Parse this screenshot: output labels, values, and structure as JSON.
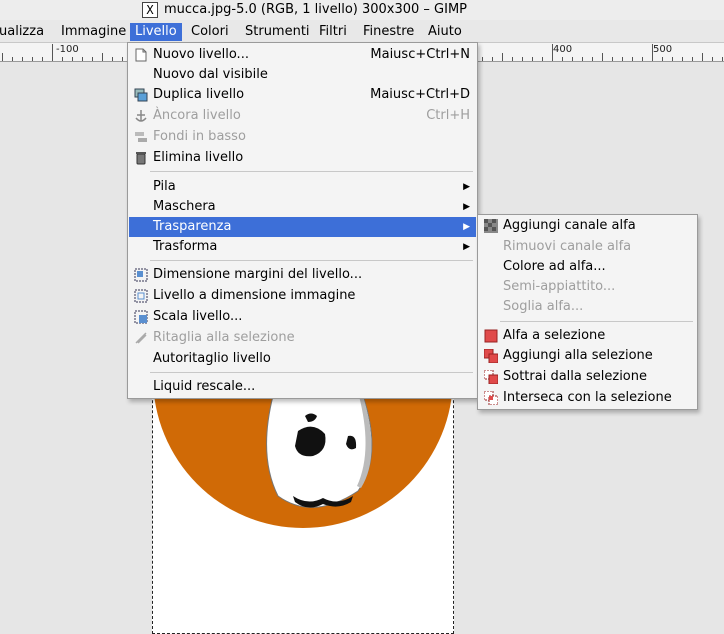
{
  "window": {
    "title": "mucca.jpg-5.0 (RGB, 1 livello) 300x300 – GIMP",
    "x_glyph": "X"
  },
  "menubar": [
    "ualizza",
    "Immagine",
    "Livello",
    "Colori",
    "Strumenti",
    "Filtri",
    "Finestre",
    "Aiuto"
  ],
  "ruler": [
    "-100",
    "400",
    "500"
  ],
  "menu": {
    "items": [
      {
        "label": "Nuovo livello...",
        "accel": "Maiusc+Ctrl+N",
        "icon": "new-layer-icon"
      },
      {
        "label": "Nuovo dal visibile"
      },
      {
        "label": "Duplica livello",
        "accel": "Maiusc+Ctrl+D",
        "icon": "duplicate-icon"
      },
      {
        "label": "Àncora livello",
        "accel": "Ctrl+H",
        "icon": "anchor-icon",
        "disabled": true
      },
      {
        "label": "Fondi in basso",
        "icon": "merge-down-icon",
        "disabled": true
      },
      {
        "label": "Elimina livello",
        "icon": "trash-icon"
      },
      {
        "label": "Pila",
        "submenu": true
      },
      {
        "label": "Maschera",
        "submenu": true
      },
      {
        "label": "Trasparenza",
        "submenu": true,
        "highlighted": true
      },
      {
        "label": "Trasforma",
        "submenu": true
      },
      {
        "label": "Dimensione margini del livello...",
        "icon": "boundary-size-icon"
      },
      {
        "label": "Livello a dimensione immagine",
        "icon": "layer-to-image-icon"
      },
      {
        "label": "Scala livello...",
        "icon": "scale-layer-icon"
      },
      {
        "label": "Ritaglia alla selezione",
        "icon": "crop-icon",
        "disabled": true
      },
      {
        "label": "Autoritaglio livello"
      },
      {
        "label": "Liquid rescale..."
      }
    ]
  },
  "submenu": {
    "items": [
      {
        "label": "Aggiungi canale alfa",
        "icon": "add-alpha-icon"
      },
      {
        "label": "Rimuovi canale alfa",
        "disabled": true
      },
      {
        "label": "Colore ad alfa..."
      },
      {
        "label": "Semi-appiattito...",
        "disabled": true
      },
      {
        "label": "Soglia alfa...",
        "disabled": true
      },
      {
        "label": "Alfa a selezione",
        "icon": "alpha-to-selection-icon"
      },
      {
        "label": "Aggiungi alla selezione",
        "icon": "add-to-selection-icon"
      },
      {
        "label": "Sottrai dalla selezione",
        "icon": "subtract-selection-icon"
      },
      {
        "label": "Interseca con la selezione",
        "icon": "intersect-selection-icon"
      }
    ]
  },
  "colors": {
    "accent": "#3d6fd8",
    "image_orange": "#d06a06"
  }
}
